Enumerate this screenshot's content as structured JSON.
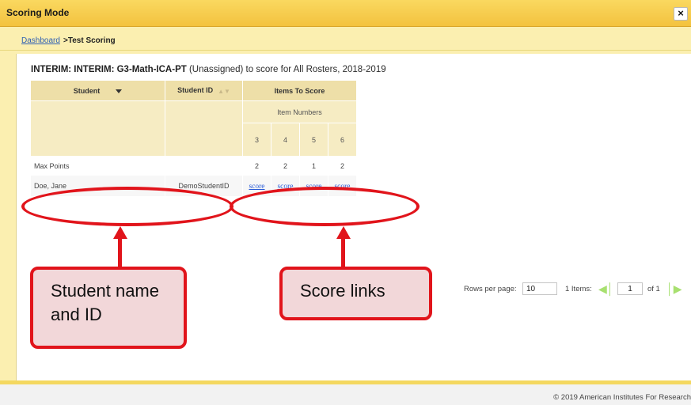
{
  "window": {
    "title": "Scoring Mode",
    "close_label": "×"
  },
  "breadcrumb": {
    "link": "Dashboard",
    "current": ">Test Scoring"
  },
  "heading": {
    "bold": "INTERIM: INTERIM: G3-Math-ICA-PT",
    "rest": " (Unassigned) to score for All Rosters, 2018-2019"
  },
  "table": {
    "col_student": "Student",
    "col_student_id": "Student ID",
    "col_items": "Items To Score",
    "col_item_numbers": "Item Numbers",
    "item_numbers": [
      "3",
      "4",
      "5",
      "6"
    ],
    "max_points_label": "Max Points",
    "max_points": [
      "2",
      "2",
      "1",
      "2"
    ],
    "rows": [
      {
        "student": "Doe, Jane",
        "student_id": "DemoStudentID",
        "links": [
          "score",
          "score",
          "score",
          "score"
        ]
      }
    ]
  },
  "pager": {
    "rows_label": "Rows per page:",
    "rows_value": "10",
    "items_label": "1 Items:",
    "page_value": "1",
    "of_label": "of 1"
  },
  "footer": {
    "copyright": "© 2019 American Institutes For Research"
  },
  "annotations": {
    "callout_left": "Student name and ID",
    "callout_right": "Score links",
    "color": "#e1141b"
  }
}
